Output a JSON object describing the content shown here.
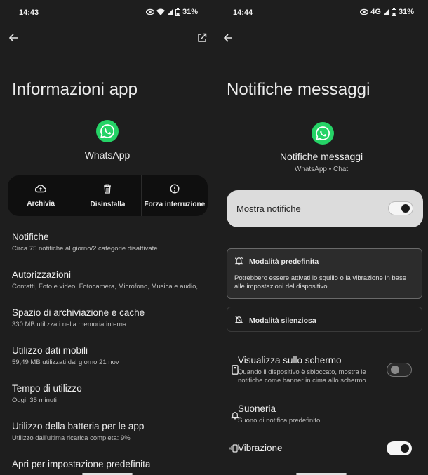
{
  "left": {
    "status": {
      "time": "14:43",
      "battery": "31%"
    },
    "title": "Informazioni app",
    "app_name": "WhatsApp",
    "actions": [
      {
        "label": "Archivia"
      },
      {
        "label": "Disinstalla"
      },
      {
        "label": "Forza interruzione"
      }
    ],
    "settings": [
      {
        "title": "Notifiche",
        "subtitle": "Circa 75 notifiche al giorno/2 categorie disattivate"
      },
      {
        "title": "Autorizzazioni",
        "subtitle": "Contatti, Foto e video, Fotocamera, Microfono, Musica e audio,..."
      },
      {
        "title": "Spazio di archiviazione e cache",
        "subtitle": "330 MB utilizzati nella memoria interna"
      },
      {
        "title": "Utilizzo dati mobili",
        "subtitle": "59,49 MB utilizzati dal giorno 21 nov"
      },
      {
        "title": "Tempo di utilizzo",
        "subtitle": "Oggi: 35 minuti"
      },
      {
        "title": "Utilizzo della batteria per le app",
        "subtitle": "Utilizzo dall'ultima ricarica completa: 9%"
      },
      {
        "title": "Apri per impostazione predefinita",
        "subtitle": ""
      }
    ]
  },
  "right": {
    "status": {
      "time": "14:44",
      "network": "4G",
      "battery": "31%"
    },
    "title": "Notifiche messaggi",
    "channel_name": "Notifiche messaggi",
    "channel_sub": "WhatsApp • Chat",
    "master_label": "Mostra notifiche",
    "master_on": true,
    "mode_default": {
      "title": "Modalità predefinita",
      "desc": "Potrebbero essere attivati lo squillo o la vibrazione in base alle impostazioni del dispositivo"
    },
    "mode_silent": {
      "title": "Modalità silenziosa"
    },
    "rows": [
      {
        "title": "Visualizza sullo schermo",
        "subtitle": "Quando il dispositivo è sbloccato, mostra le notifiche come banner in cima allo schermo",
        "toggle": false
      },
      {
        "title": "Suoneria",
        "subtitle": "Suono di notifica predefinito"
      },
      {
        "title": "Vibrazione",
        "subtitle": "",
        "toggle": true
      }
    ]
  },
  "colors": {
    "background": "#1e1e1e",
    "whatsapp_green": "#25d366",
    "card_dark": "#0f0f0f",
    "master_card": "#dcdcdc"
  }
}
